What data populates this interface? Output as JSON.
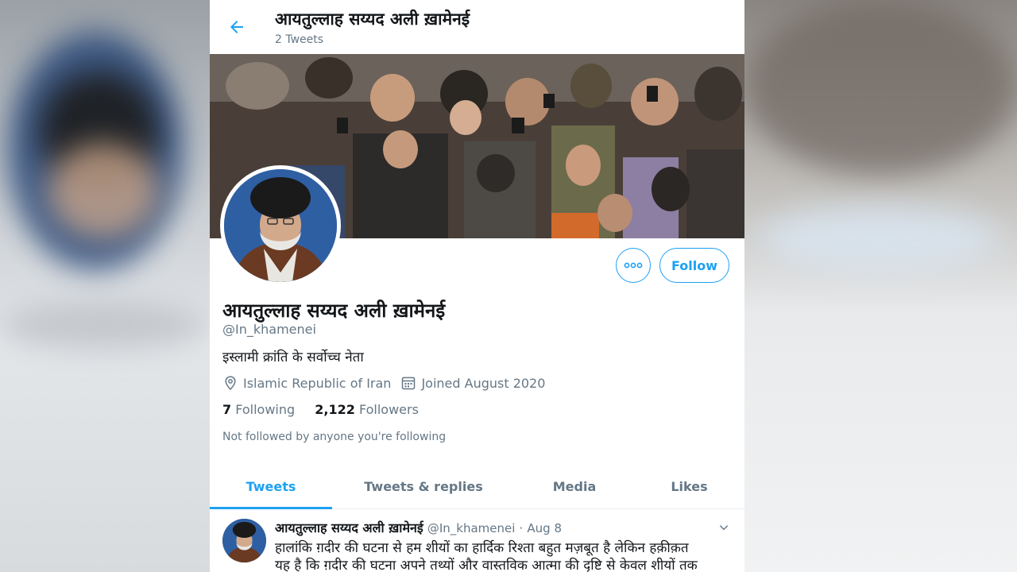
{
  "header": {
    "title": "आयतुल्लाह सय्यद अली ख़ामेनई",
    "tweet_count": "2 Tweets"
  },
  "profile": {
    "name": "आयतुल्लाह सय्यद अली ख़ामेनई",
    "handle": "@In_khamenei",
    "bio": "इस्लामी क्रांति के सर्वोच्च नेता",
    "location": "Islamic Republic of Iran",
    "joined": "Joined August 2020",
    "following_count": "7",
    "following_label": "Following",
    "followers_count": "2,122",
    "followers_label": "Followers",
    "not_followed": "Not followed by anyone you're following",
    "follow_label": "Follow"
  },
  "tabs": [
    {
      "label": "Tweets",
      "active": true
    },
    {
      "label": "Tweets & replies",
      "active": false
    },
    {
      "label": "Media",
      "active": false
    },
    {
      "label": "Likes",
      "active": false
    }
  ],
  "tweet": {
    "name": "आयतुल्लाह सय्यद अली ख़ामेनई",
    "handle": "@In_khamenei",
    "dot": "·",
    "date": "Aug 8",
    "line1": "हालांकि ग़दीर की घटना से हम शीयों का हार्दिक रिश्ता बहुत मज़बूत है लेकिन हक़ीक़त",
    "line2": "यह है कि ग़दीर की घटना अपने तथ्यों और वास्तविक आत्मा की दृष्टि से केवल शीयों तक"
  },
  "colors": {
    "accent": "#1da1f2",
    "secondary_text": "#657786",
    "primary_text": "#14171a"
  },
  "icons": [
    "back-arrow-icon",
    "more-icon",
    "location-icon",
    "calendar-icon",
    "chevron-down-icon"
  ]
}
